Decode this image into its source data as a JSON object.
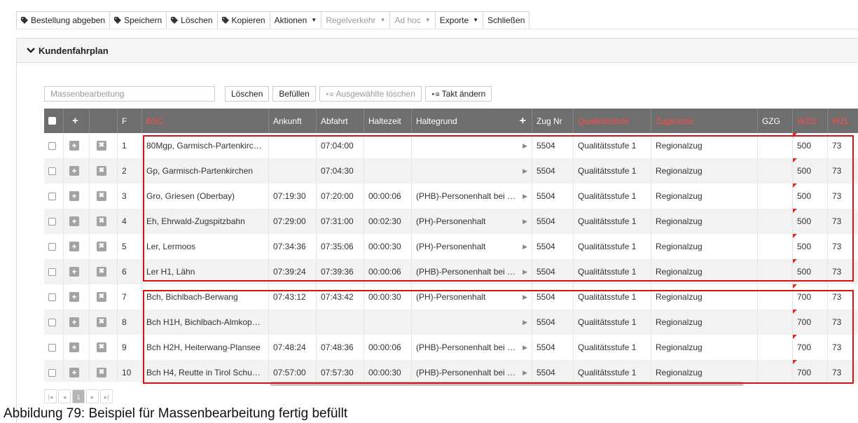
{
  "toolbar": {
    "submit_order": "Bestellung abgeben",
    "save": "Speichern",
    "delete": "Löschen",
    "copy": "Kopieren",
    "actions": "Aktionen",
    "regular_traffic": "Regelverkehr",
    "ad_hoc": "Ad hoc",
    "exports": "Exporte",
    "close": "Schließen"
  },
  "panel": {
    "title": "Kundenfahrplan"
  },
  "mass_edit": {
    "placeholder": "Massenbearbeitung",
    "delete_label": "Löschen",
    "fill_label": "Befüllen",
    "delete_selected_label": "Ausgewählte löschen",
    "change_interval_label": "Takt ändern"
  },
  "table": {
    "headers": {
      "f": "F",
      "bsc": "BSC",
      "arrival": "Ankunft",
      "departure": "Abfahrt",
      "stop_time": "Haltezeit",
      "stop_reason": "Haltegrund",
      "train_no": "Zug Nr",
      "quality_level": "Qualitätsstufe",
      "train_class": "Zugklasse",
      "gzg": "GZG",
      "wzg": "WZG",
      "wzl": "WZL"
    },
    "rows": [
      {
        "f": "1",
        "bsc": "80Mgp, Garmisch-Partenkirc…",
        "arrival": "",
        "departure": "07:04:00",
        "stop_time": "",
        "reason": "",
        "train": "5504",
        "quality": "Qualitätsstufe 1",
        "class": "Regionalzug",
        "gzg": "",
        "wzg": "500",
        "wzl": "73"
      },
      {
        "f": "2",
        "bsc": "Gp, Garmisch-Partenkirchen",
        "arrival": "",
        "departure": "07:04:30",
        "stop_time": "",
        "reason": "",
        "train": "5504",
        "quality": "Qualitätsstufe 1",
        "class": "Regionalzug",
        "gzg": "",
        "wzg": "500",
        "wzl": "73"
      },
      {
        "f": "3",
        "bsc": "Gro, Griesen (Oberbay)",
        "arrival": "07:19:30",
        "departure": "07:20:00",
        "stop_time": "00:00:06",
        "reason": "(PHB)-Personenhalt bei …",
        "train": "5504",
        "quality": "Qualitätsstufe 1",
        "class": "Regionalzug",
        "gzg": "",
        "wzg": "500",
        "wzl": "73"
      },
      {
        "f": "4",
        "bsc": "Eh, Ehrwald-Zugspitzbahn",
        "arrival": "07:29:00",
        "departure": "07:31:00",
        "stop_time": "00:02:30",
        "reason": "(PH)-Personenhalt",
        "train": "5504",
        "quality": "Qualitätsstufe 1",
        "class": "Regionalzug",
        "gzg": "",
        "wzg": "500",
        "wzl": "73"
      },
      {
        "f": "5",
        "bsc": "Ler, Lermoos",
        "arrival": "07:34:36",
        "departure": "07:35:06",
        "stop_time": "00:00:30",
        "reason": "(PH)-Personenhalt",
        "train": "5504",
        "quality": "Qualitätsstufe 1",
        "class": "Regionalzug",
        "gzg": "",
        "wzg": "500",
        "wzl": "73"
      },
      {
        "f": "6",
        "bsc": "Ler H1, Lähn",
        "arrival": "07:39:24",
        "departure": "07:39:36",
        "stop_time": "00:00:06",
        "reason": "(PHB)-Personenhalt bei …",
        "train": "5504",
        "quality": "Qualitätsstufe 1",
        "class": "Regionalzug",
        "gzg": "",
        "wzg": "500",
        "wzl": "73"
      },
      {
        "f": "7",
        "bsc": "Bch, Bichlbach-Berwang",
        "arrival": "07:43:12",
        "departure": "07:43:42",
        "stop_time": "00:00:30",
        "reason": "(PH)-Personenhalt",
        "train": "5504",
        "quality": "Qualitätsstufe 1",
        "class": "Regionalzug",
        "gzg": "",
        "wzg": "700",
        "wzl": "73"
      },
      {
        "f": "8",
        "bsc": "Bch H1H, Bichlbach-Almkop…",
        "arrival": "",
        "departure": "",
        "stop_time": "",
        "reason": "",
        "train": "5504",
        "quality": "Qualitätsstufe 1",
        "class": "Regionalzug",
        "gzg": "",
        "wzg": "700",
        "wzl": "73"
      },
      {
        "f": "9",
        "bsc": "Bch H2H, Heiterwang-Plansee",
        "arrival": "07:48:24",
        "departure": "07:48:36",
        "stop_time": "00:00:06",
        "reason": "(PHB)-Personenhalt bei …",
        "train": "5504",
        "quality": "Qualitätsstufe 1",
        "class": "Regionalzug",
        "gzg": "",
        "wzg": "700",
        "wzl": "73"
      },
      {
        "f": "10",
        "bsc": "Bch H4, Reutte in Tirol Schu…",
        "arrival": "07:57:00",
        "departure": "07:57:30",
        "stop_time": "00:00:30",
        "reason": "(PHB)-Personenhalt bei …",
        "train": "5504",
        "quality": "Qualitätsstufe 1",
        "class": "Regionalzug",
        "gzg": "",
        "wzg": "700",
        "wzl": "73"
      }
    ]
  },
  "pager": {
    "current_page": "1"
  },
  "caption": "Abbildung 79: Beispiel für Massenbearbeitung fertig befüllt",
  "colors": {
    "header_bg": "#6e6e6e",
    "required_header": "#ff4b4b",
    "highlight": "#dd1111",
    "flag": "#ee2222"
  }
}
